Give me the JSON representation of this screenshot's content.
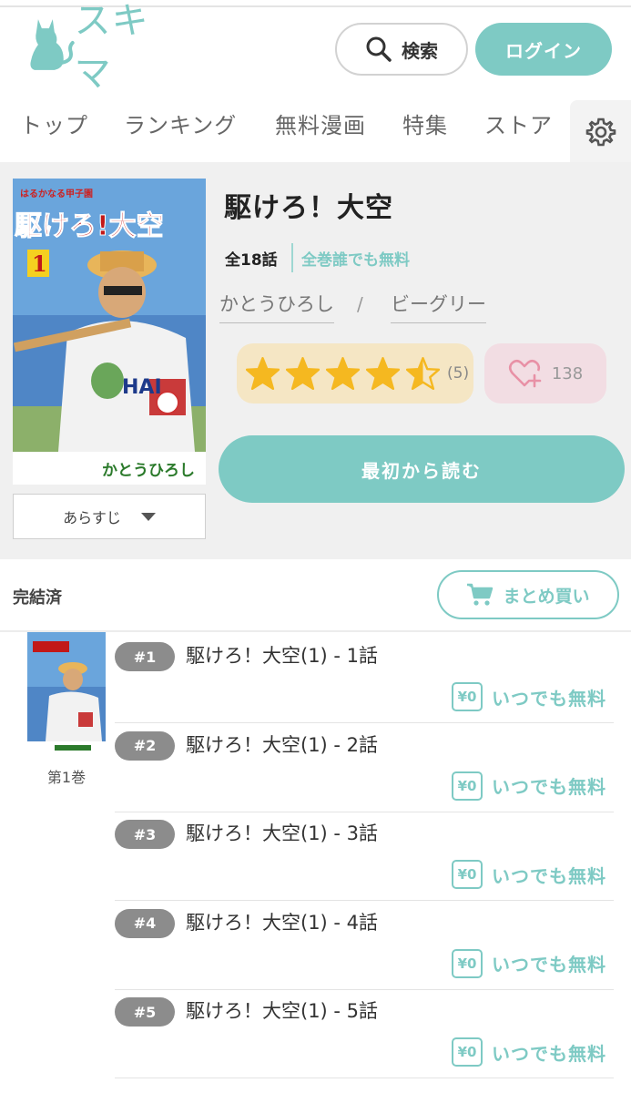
{
  "header": {
    "logo_text": "スキマ",
    "search_label": "検索",
    "login_label": "ログイン"
  },
  "nav": {
    "items": [
      "トップ",
      "ランキング",
      "無料漫画",
      "特集",
      "ストア"
    ],
    "settings_icon": "gear-icon"
  },
  "book": {
    "title": "駆けろ！大空",
    "episode_count": "全18話",
    "free_note": "全巻誰でも無料",
    "author": "かとうひろし",
    "separator": "/",
    "publisher": "ビーグリー",
    "rating_value": 4.5,
    "rating_count": "(5)",
    "favorites": "138",
    "read_button": "最初から読む",
    "synopsis_button": "あらすじ",
    "cover_title": "駆けろ!大空",
    "cover_subtitle": "はるかなる甲子園",
    "cover_author": "かとうひろし",
    "cover_volume": "1"
  },
  "list": {
    "status": "完結済",
    "bulk_buy": "まとめ買い",
    "volume_label": "第1巻",
    "episodes": [
      {
        "num": "#1",
        "title": "駆けろ！大空(1) - 1話",
        "price": "¥0",
        "free": "いつでも無料"
      },
      {
        "num": "#2",
        "title": "駆けろ！大空(1) - 2話",
        "price": "¥0",
        "free": "いつでも無料"
      },
      {
        "num": "#3",
        "title": "駆けろ！大空(1) - 3話",
        "price": "¥0",
        "free": "いつでも無料"
      },
      {
        "num": "#4",
        "title": "駆けろ！大空(1) - 4話",
        "price": "¥0",
        "free": "いつでも無料"
      },
      {
        "num": "#5",
        "title": "駆けろ！大空(1) - 5話",
        "price": "¥0",
        "free": "いつでも無料"
      }
    ]
  },
  "colors": {
    "accent": "#7ecac4",
    "star": "#f5b820",
    "rating_bg": "#f5e6c4",
    "fav_bg": "#f2dde3",
    "fav_icon": "#e891a6",
    "badge": "#8c8c8c"
  }
}
